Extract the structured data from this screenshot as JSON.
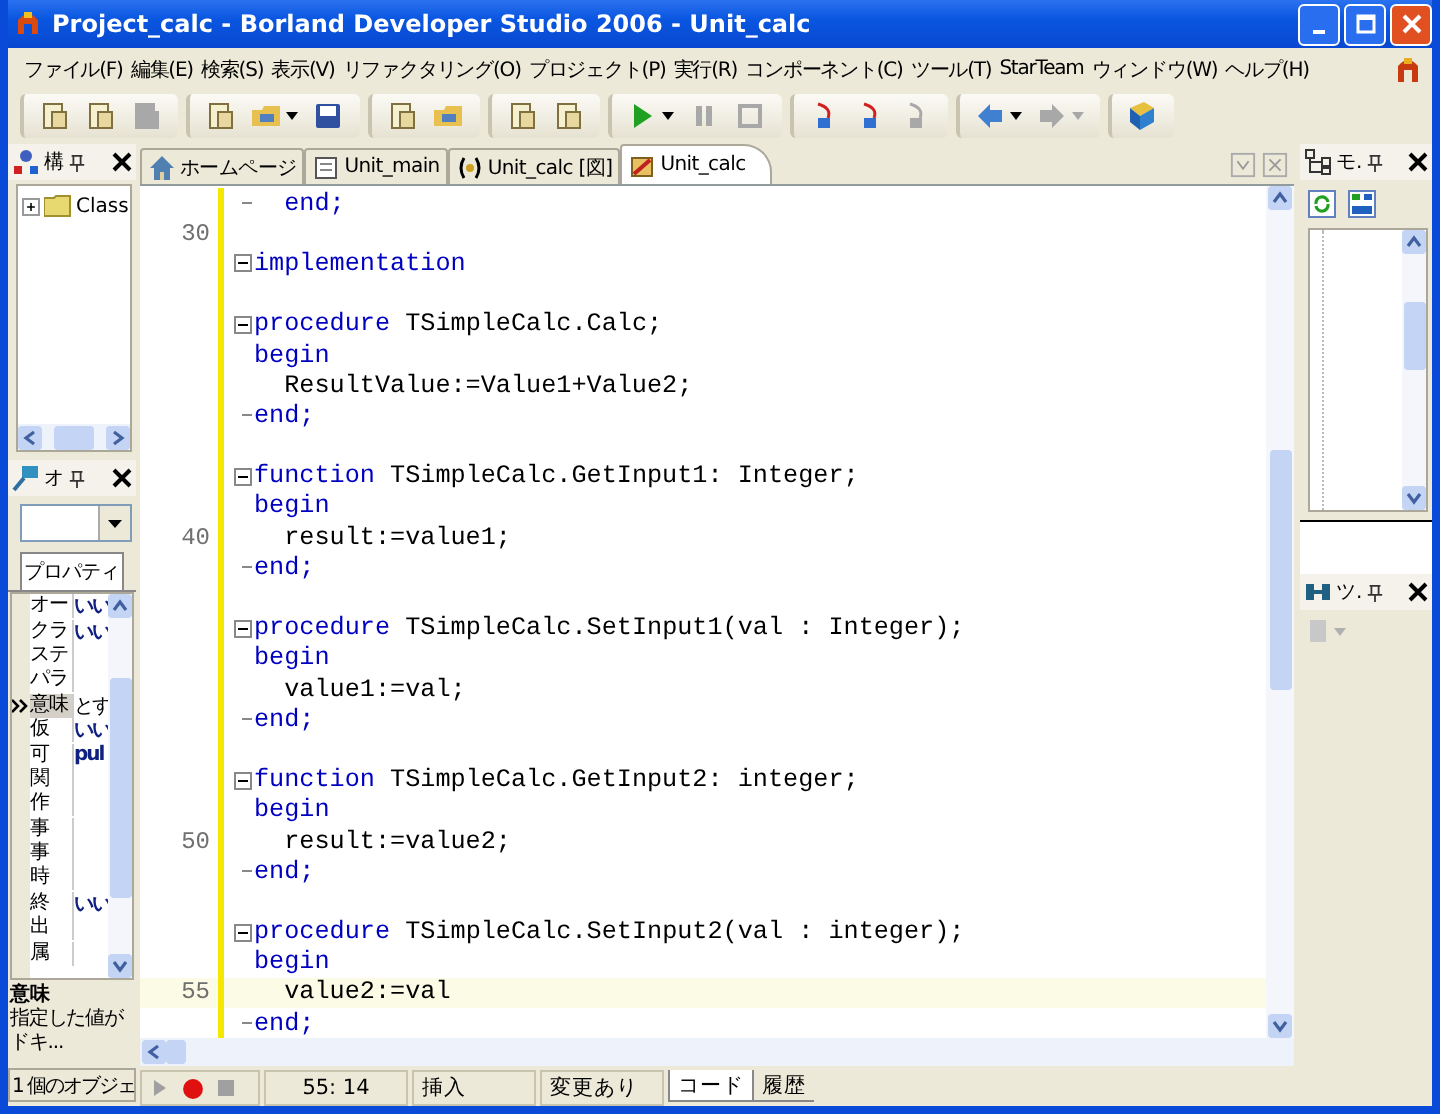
{
  "window": {
    "title": "Project_calc - Borland Developer Studio 2006 - Unit_calc"
  },
  "menu": [
    "ファイル(F)",
    "編集(E)",
    "検索(S)",
    "表示(V)",
    "リファクタリング(O)",
    "プロジェクト(P)",
    "実行(R)",
    "コンポーネント(C)",
    "ツール(T)",
    "StarTeam",
    "ウィンドウ(W)",
    "ヘルプ(H)"
  ],
  "toolbar": [
    {
      "disabled": false
    },
    {
      "disabled": false
    },
    {
      "disabled": true
    },
    {
      "disabled": false
    },
    {
      "disabled": false
    },
    {
      "disabled": false
    },
    {
      "disabled": false
    },
    {
      "disabled": false
    },
    {
      "disabled": false
    },
    {
      "disabled": false
    },
    {
      "disabled": false
    },
    {
      "disabled": true
    },
    {
      "disabled": true
    },
    {
      "disabled": false
    },
    {
      "disabled": false
    },
    {
      "disabled": true
    },
    {
      "disabled": false
    },
    {
      "disabled": true
    },
    {
      "disabled": false
    }
  ],
  "structure_panel": {
    "title": "構",
    "tree": [
      {
        "label": "Class",
        "expanded": false
      }
    ]
  },
  "object_inspector": {
    "title": "オ",
    "tabs": [
      {
        "label": "プロパティ",
        "selected": true
      }
    ],
    "rows": [
      {
        "name": "オー",
        "value": "いい",
        "selected": false
      },
      {
        "name": "クラ",
        "value": "いい",
        "selected": false
      },
      {
        "name": "ステ",
        "selected": false
      },
      {
        "name": "パラ",
        "selected": false
      },
      {
        "name": "意味",
        "value": "とす",
        "selected": true
      },
      {
        "name": "仮",
        "value": "いい",
        "selected": false
      },
      {
        "name": "可",
        "value": "pul",
        "selected": false
      },
      {
        "name": "関",
        "selected": false
      },
      {
        "name": "作",
        "selected": false
      },
      {
        "name": "事",
        "selected": false
      },
      {
        "name": "事",
        "selected": false
      },
      {
        "name": "時",
        "selected": false
      },
      {
        "name": "終",
        "value": "いい",
        "selected": false
      },
      {
        "name": "出",
        "selected": false
      },
      {
        "name": "属",
        "selected": false
      }
    ],
    "description": {
      "title": "意味",
      "text": "指定した値が",
      "more": "ドキ..."
    },
    "status": "1 個のオブジェ"
  },
  "editor": {
    "tabs": [
      {
        "label": "ホームページ",
        "kind": "home",
        "selected": false
      },
      {
        "label": "Unit_main",
        "kind": "unit",
        "selected": false
      },
      {
        "label": "Unit_calc [図]",
        "kind": "diagram",
        "selected": false
      },
      {
        "label": "Unit_calc",
        "kind": "code",
        "selected": true
      }
    ],
    "lines": [
      {
        "tokens": [
          {
            "text": "  end;",
            "kind": "keyword"
          }
        ],
        "kind": "close",
        "current": false
      },
      {
        "number": "30",
        "kind": "plain",
        "current": false
      },
      {
        "tokens": [
          {
            "text": "implementation",
            "kind": "keyword"
          }
        ],
        "kind": "open",
        "current": false
      },
      {
        "kind": "plain",
        "current": false
      },
      {
        "tokens": [
          {
            "text": "procedure",
            "kind": "keyword"
          },
          {
            "text": " TSimpleCalc.Calc;",
            "kind": "plain"
          }
        ],
        "kind": "open",
        "current": false
      },
      {
        "tokens": [
          {
            "text": "begin",
            "kind": "keyword"
          }
        ],
        "kind": "plain",
        "current": false
      },
      {
        "tokens": [
          {
            "text": "  ResultValue:=Value1+Value2;",
            "kind": "plain"
          }
        ],
        "kind": "plain",
        "current": false
      },
      {
        "tokens": [
          {
            "text": "end;",
            "kind": "keyword"
          }
        ],
        "kind": "close",
        "current": false
      },
      {
        "kind": "plain",
        "current": false
      },
      {
        "tokens": [
          {
            "text": "function",
            "kind": "keyword"
          },
          {
            "text": " TSimpleCalc.GetInput1: Integer;",
            "kind": "plain"
          }
        ],
        "kind": "open",
        "current": false
      },
      {
        "tokens": [
          {
            "text": "begin",
            "kind": "keyword"
          }
        ],
        "kind": "plain",
        "current": false
      },
      {
        "number": "40",
        "tokens": [
          {
            "text": "  result:=value1;",
            "kind": "plain"
          }
        ],
        "kind": "plain",
        "current": false
      },
      {
        "tokens": [
          {
            "text": "end;",
            "kind": "keyword"
          }
        ],
        "kind": "close",
        "current": false
      },
      {
        "kind": "plain",
        "current": false
      },
      {
        "tokens": [
          {
            "text": "procedure",
            "kind": "keyword"
          },
          {
            "text": " TSimpleCalc.SetInput1(val : Integer);",
            "kind": "plain"
          }
        ],
        "kind": "open",
        "current": false
      },
      {
        "tokens": [
          {
            "text": "begin",
            "kind": "keyword"
          }
        ],
        "kind": "plain",
        "current": false
      },
      {
        "tokens": [
          {
            "text": "  value1:=val;",
            "kind": "plain"
          }
        ],
        "kind": "plain",
        "current": false
      },
      {
        "tokens": [
          {
            "text": "end;",
            "kind": "keyword"
          }
        ],
        "kind": "close",
        "current": false
      },
      {
        "kind": "plain",
        "current": false
      },
      {
        "tokens": [
          {
            "text": "function",
            "kind": "keyword"
          },
          {
            "text": " TSimpleCalc.GetInput2: integer;",
            "kind": "plain"
          }
        ],
        "kind": "open",
        "current": false
      },
      {
        "tokens": [
          {
            "text": "begin",
            "kind": "keyword"
          }
        ],
        "kind": "plain",
        "current": false
      },
      {
        "number": "50",
        "tokens": [
          {
            "text": "  result:=value2;",
            "kind": "plain"
          }
        ],
        "kind": "plain",
        "current": false
      },
      {
        "tokens": [
          {
            "text": "end;",
            "kind": "keyword"
          }
        ],
        "kind": "close",
        "current": false
      },
      {
        "kind": "plain",
        "current": false
      },
      {
        "tokens": [
          {
            "text": "procedure",
            "kind": "keyword"
          },
          {
            "text": " TSimpleCalc.SetInput2(val : integer);",
            "kind": "plain"
          }
        ],
        "kind": "open",
        "current": false
      },
      {
        "tokens": [
          {
            "text": "begin",
            "kind": "keyword"
          }
        ],
        "kind": "plain",
        "current": false
      },
      {
        "number": "55",
        "tokens": [
          {
            "text": "  value2:=val",
            "kind": "plain"
          }
        ],
        "kind": "plain",
        "current": true
      },
      {
        "tokens": [
          {
            "text": "end;",
            "kind": "keyword"
          }
        ],
        "kind": "close",
        "current": false
      }
    ]
  },
  "model_panel": {
    "title": "モ."
  },
  "tool_palette": {
    "title": "ツ."
  },
  "status_bar": {
    "position": "55: 14",
    "mode": "挿入",
    "modified": "変更あり",
    "tabs": [
      {
        "label": "コード",
        "selected": true
      },
      {
        "label": "履歴",
        "selected": false
      }
    ]
  }
}
